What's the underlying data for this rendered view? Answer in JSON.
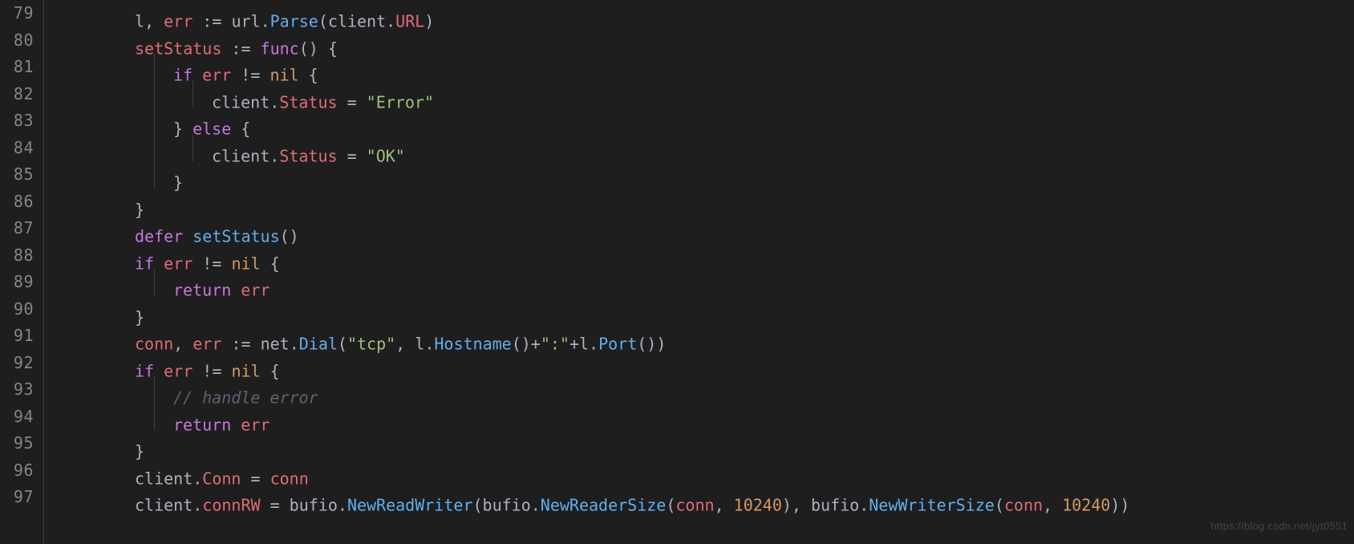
{
  "watermark": "https://blog.csdn.net/jyt0551",
  "lineStart": 79,
  "guideSpacing": 48,
  "baseIndentPx": 96,
  "lines": [
    {
      "num": 79,
      "indent": 2,
      "tokens": [
        {
          "t": "l",
          "c": "ident"
        },
        {
          "t": ", ",
          "c": "punc"
        },
        {
          "t": "err",
          "c": "var"
        },
        {
          "t": " := ",
          "c": "op"
        },
        {
          "t": "url",
          "c": "ident"
        },
        {
          "t": ".",
          "c": "punc"
        },
        {
          "t": "Parse",
          "c": "call"
        },
        {
          "t": "(",
          "c": "punc"
        },
        {
          "t": "client",
          "c": "ident"
        },
        {
          "t": ".",
          "c": "punc"
        },
        {
          "t": "URL",
          "c": "prop"
        },
        {
          "t": ")",
          "c": "punc"
        }
      ]
    },
    {
      "num": 80,
      "indent": 2,
      "tokens": [
        {
          "t": "setStatus",
          "c": "var"
        },
        {
          "t": " := ",
          "c": "op"
        },
        {
          "t": "func",
          "c": "keyword"
        },
        {
          "t": "() {",
          "c": "punc"
        }
      ]
    },
    {
      "num": 81,
      "indent": 3,
      "tokens": [
        {
          "t": "if",
          "c": "keyword"
        },
        {
          "t": " ",
          "c": "op"
        },
        {
          "t": "err",
          "c": "var"
        },
        {
          "t": " != ",
          "c": "op"
        },
        {
          "t": "nil",
          "c": "const"
        },
        {
          "t": " {",
          "c": "punc"
        }
      ]
    },
    {
      "num": 82,
      "indent": 4,
      "tokens": [
        {
          "t": "client",
          "c": "ident"
        },
        {
          "t": ".",
          "c": "punc"
        },
        {
          "t": "Status",
          "c": "prop"
        },
        {
          "t": " = ",
          "c": "op"
        },
        {
          "t": "\"Error\"",
          "c": "string"
        }
      ]
    },
    {
      "num": 83,
      "indent": 3,
      "tokens": [
        {
          "t": "} ",
          "c": "punc"
        },
        {
          "t": "else",
          "c": "keyword"
        },
        {
          "t": " {",
          "c": "punc"
        }
      ]
    },
    {
      "num": 84,
      "indent": 4,
      "tokens": [
        {
          "t": "client",
          "c": "ident"
        },
        {
          "t": ".",
          "c": "punc"
        },
        {
          "t": "Status",
          "c": "prop"
        },
        {
          "t": " = ",
          "c": "op"
        },
        {
          "t": "\"OK\"",
          "c": "string"
        }
      ]
    },
    {
      "num": 85,
      "indent": 3,
      "tokens": [
        {
          "t": "}",
          "c": "punc"
        }
      ]
    },
    {
      "num": 86,
      "indent": 2,
      "tokens": [
        {
          "t": "}",
          "c": "punc"
        }
      ]
    },
    {
      "num": 87,
      "indent": 2,
      "tokens": [
        {
          "t": "defer",
          "c": "keyword"
        },
        {
          "t": " ",
          "c": "op"
        },
        {
          "t": "setStatus",
          "c": "call"
        },
        {
          "t": "()",
          "c": "punc"
        }
      ]
    },
    {
      "num": 88,
      "indent": 2,
      "tokens": [
        {
          "t": "if",
          "c": "keyword"
        },
        {
          "t": " ",
          "c": "op"
        },
        {
          "t": "err",
          "c": "var"
        },
        {
          "t": " != ",
          "c": "op"
        },
        {
          "t": "nil",
          "c": "const"
        },
        {
          "t": " {",
          "c": "punc"
        }
      ]
    },
    {
      "num": 89,
      "indent": 3,
      "tokens": [
        {
          "t": "return",
          "c": "keyword"
        },
        {
          "t": " ",
          "c": "op"
        },
        {
          "t": "err",
          "c": "var"
        }
      ]
    },
    {
      "num": 90,
      "indent": 2,
      "tokens": [
        {
          "t": "}",
          "c": "punc"
        }
      ]
    },
    {
      "num": 91,
      "indent": 2,
      "tokens": [
        {
          "t": "conn",
          "c": "var"
        },
        {
          "t": ", ",
          "c": "punc"
        },
        {
          "t": "err",
          "c": "var"
        },
        {
          "t": " := ",
          "c": "op"
        },
        {
          "t": "net",
          "c": "ident"
        },
        {
          "t": ".",
          "c": "punc"
        },
        {
          "t": "Dial",
          "c": "call"
        },
        {
          "t": "(",
          "c": "punc"
        },
        {
          "t": "\"tcp\"",
          "c": "string"
        },
        {
          "t": ", ",
          "c": "punc"
        },
        {
          "t": "l",
          "c": "ident"
        },
        {
          "t": ".",
          "c": "punc"
        },
        {
          "t": "Hostname",
          "c": "call"
        },
        {
          "t": "()",
          "c": "punc"
        },
        {
          "t": "+",
          "c": "op"
        },
        {
          "t": "\":\"",
          "c": "string"
        },
        {
          "t": "+",
          "c": "op"
        },
        {
          "t": "l",
          "c": "ident"
        },
        {
          "t": ".",
          "c": "punc"
        },
        {
          "t": "Port",
          "c": "call"
        },
        {
          "t": "())",
          "c": "punc"
        }
      ]
    },
    {
      "num": 92,
      "indent": 2,
      "tokens": [
        {
          "t": "if",
          "c": "keyword"
        },
        {
          "t": " ",
          "c": "op"
        },
        {
          "t": "err",
          "c": "var"
        },
        {
          "t": " != ",
          "c": "op"
        },
        {
          "t": "nil",
          "c": "const"
        },
        {
          "t": " {",
          "c": "punc"
        }
      ]
    },
    {
      "num": 93,
      "indent": 3,
      "tokens": [
        {
          "t": "// handle error",
          "c": "comment"
        }
      ]
    },
    {
      "num": 94,
      "indent": 3,
      "tokens": [
        {
          "t": "return",
          "c": "keyword"
        },
        {
          "t": " ",
          "c": "op"
        },
        {
          "t": "err",
          "c": "var"
        }
      ]
    },
    {
      "num": 95,
      "indent": 2,
      "tokens": [
        {
          "t": "}",
          "c": "punc"
        }
      ]
    },
    {
      "num": 96,
      "indent": 2,
      "tokens": [
        {
          "t": "client",
          "c": "ident"
        },
        {
          "t": ".",
          "c": "punc"
        },
        {
          "t": "Conn",
          "c": "prop"
        },
        {
          "t": " = ",
          "c": "op"
        },
        {
          "t": "conn",
          "c": "var"
        }
      ]
    },
    {
      "num": 97,
      "indent": 2,
      "tokens": [
        {
          "t": "client",
          "c": "ident"
        },
        {
          "t": ".",
          "c": "punc"
        },
        {
          "t": "connRW",
          "c": "prop"
        },
        {
          "t": " = ",
          "c": "op"
        },
        {
          "t": "bufio",
          "c": "ident"
        },
        {
          "t": ".",
          "c": "punc"
        },
        {
          "t": "NewReadWriter",
          "c": "call"
        },
        {
          "t": "(",
          "c": "punc"
        },
        {
          "t": "bufio",
          "c": "ident"
        },
        {
          "t": ".",
          "c": "punc"
        },
        {
          "t": "NewReaderSize",
          "c": "call"
        },
        {
          "t": "(",
          "c": "punc"
        },
        {
          "t": "conn",
          "c": "var"
        },
        {
          "t": ", ",
          "c": "punc"
        },
        {
          "t": "10240",
          "c": "number"
        },
        {
          "t": "), ",
          "c": "punc"
        },
        {
          "t": "bufio",
          "c": "ident"
        },
        {
          "t": ".",
          "c": "punc"
        },
        {
          "t": "NewWriterSize",
          "c": "call"
        },
        {
          "t": "(",
          "c": "punc"
        },
        {
          "t": "conn",
          "c": "var"
        },
        {
          "t": ", ",
          "c": "punc"
        },
        {
          "t": "10240",
          "c": "number"
        },
        {
          "t": "))",
          "c": "punc"
        }
      ]
    }
  ]
}
